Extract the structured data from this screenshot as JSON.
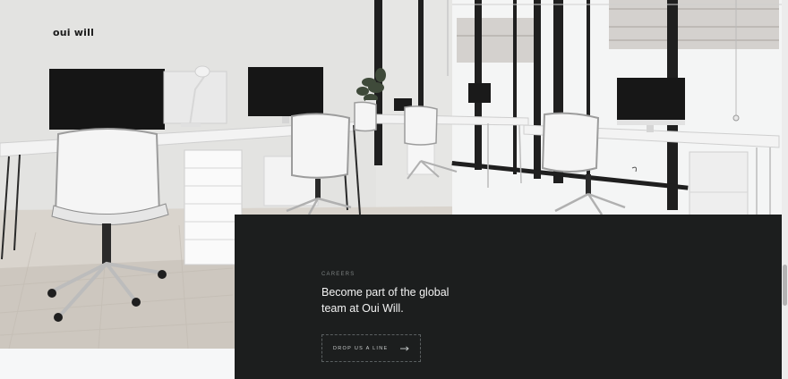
{
  "brand": {
    "logo_text": "oui will"
  },
  "careers": {
    "eyebrow": "Careers",
    "headline": "Become part of the global team at Oui Will.",
    "cta_label": "Drop us a line",
    "cta_icon": "arrow-right-icon"
  },
  "hero": {
    "image": "office-photo"
  },
  "colors": {
    "panel_background": "#1c1e1e",
    "page_background": "#f6f7f8",
    "headline_text": "#f2f2f2"
  }
}
